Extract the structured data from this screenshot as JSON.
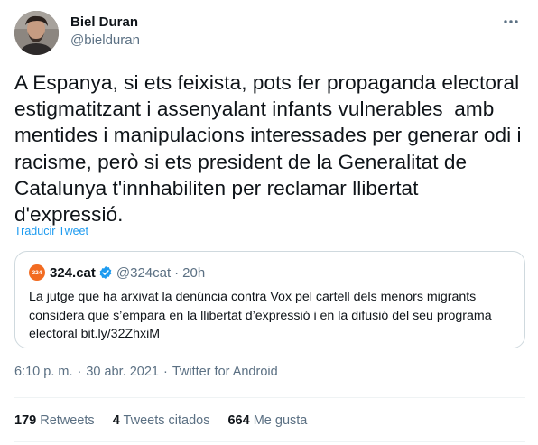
{
  "author": {
    "name": "Biel Duran",
    "handle": "@bielduran"
  },
  "tweet": {
    "text": "A Espanya, si ets feixista, pots fer propaganda electoral\nestigmatitzant i assenyalant infants vulnerables  amb\nmentides i manipulacions interessades per generar odi i\nracisme, però si ets president de la Generalitat de\nCatalunya t'innhabiliten per reclamar llibertat\nd'expressió.",
    "translate_label": "Traducir Tweet"
  },
  "quote": {
    "logo_text": "324",
    "name": "324.cat",
    "handle": "@324cat",
    "dot": "·",
    "time": "20h",
    "text": "La jutge que ha arxivat la denúncia contra Vox pel cartell dels menors migrants considera que s’empara en la llibertat d’expressió i en la difusió del seu programa electoral bit.ly/32ZhxiM"
  },
  "meta": {
    "time": "6:10 p. m.",
    "sep": "·",
    "date": "30 abr. 2021",
    "source": "Twitter for Android"
  },
  "stats": {
    "retweets_count": "179",
    "retweets_label": "Retweets",
    "quotes_count": "4",
    "quotes_label": "Tweets citados",
    "likes_count": "664",
    "likes_label": "Me gusta"
  },
  "colors": {
    "link": "#1d9bf0",
    "secondary_text": "#5b7083",
    "border": "#cfd9de",
    "quote_logo": "#f26b21"
  },
  "icons": {
    "more": "more-horizontal-icon",
    "verified": "verified-badge-icon"
  }
}
